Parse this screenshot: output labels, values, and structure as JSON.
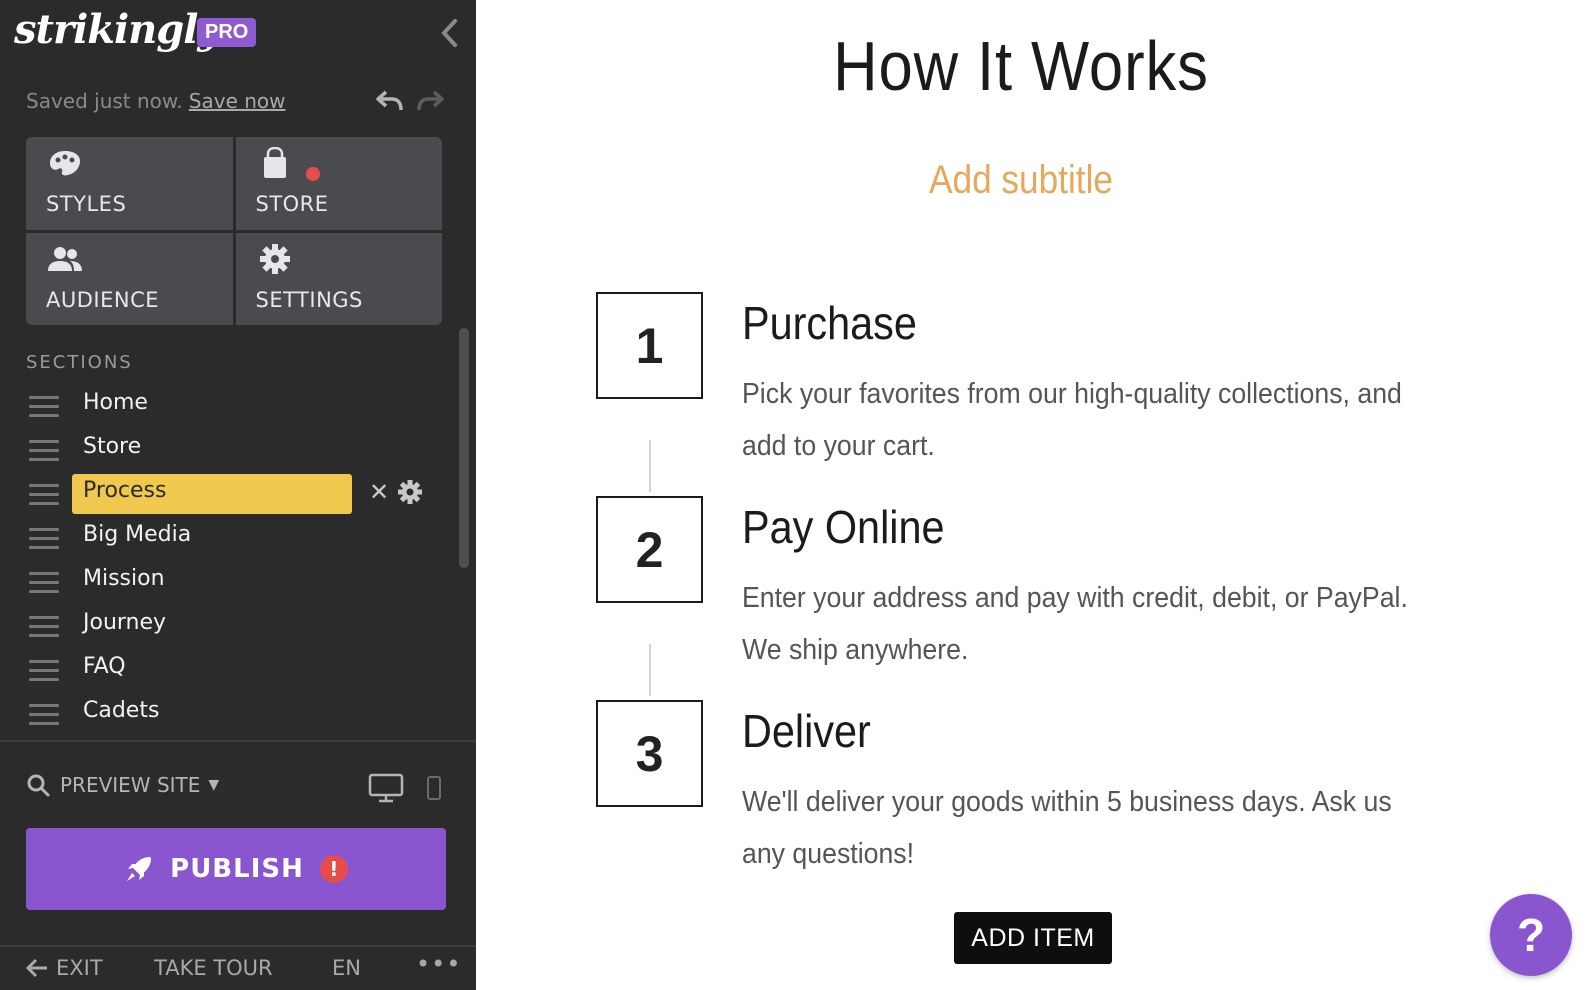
{
  "sidebar": {
    "logo": "strikingly",
    "badge": "PRO",
    "saved_status": "Saved just now.",
    "save_link": "Save now",
    "tiles": [
      {
        "label": "STYLES",
        "icon": "palette-icon"
      },
      {
        "label": "STORE",
        "icon": "shopping-bag-icon"
      },
      {
        "label": "AUDIENCE",
        "icon": "people-icon"
      },
      {
        "label": "SETTINGS",
        "icon": "gear-icon"
      }
    ],
    "sections_heading": "SECTIONS",
    "sections": [
      {
        "label": "Home"
      },
      {
        "label": "Store"
      },
      {
        "label": "Process",
        "active": true
      },
      {
        "label": "Big Media"
      },
      {
        "label": "Mission"
      },
      {
        "label": "Journey"
      },
      {
        "label": "FAQ"
      },
      {
        "label": "Cadets"
      }
    ],
    "preview_label": "PREVIEW SITE",
    "publish_label": "PUBLISH",
    "publish_warning": "!",
    "footer": {
      "exit": "EXIT",
      "tour": "TAKE TOUR",
      "lang": "EN",
      "more": "•••"
    }
  },
  "main": {
    "title": "How It Works",
    "subtitle": "Add subtitle",
    "steps": [
      {
        "number": "1",
        "title": "Purchase",
        "description": "Pick your favorites from our high-quality collections, and add to your cart."
      },
      {
        "number": "2",
        "title": "Pay Online",
        "description": "Enter your address and pay with credit, debit, or PayPal. We ship anywhere."
      },
      {
        "number": "3",
        "title": "Deliver",
        "description": "We'll deliver your goods within 5 business days. Ask us any questions!"
      }
    ],
    "add_item_label": "ADD ITEM",
    "help_label": "?"
  },
  "colors": {
    "sidebar_bg": "#2b2b2c",
    "tile_bg": "#4a4b4f",
    "accent_purple": "#8a56d0",
    "active_section": "#f0c84e",
    "subtitle": "#e6a85a",
    "alert_red": "#e74c4c"
  }
}
